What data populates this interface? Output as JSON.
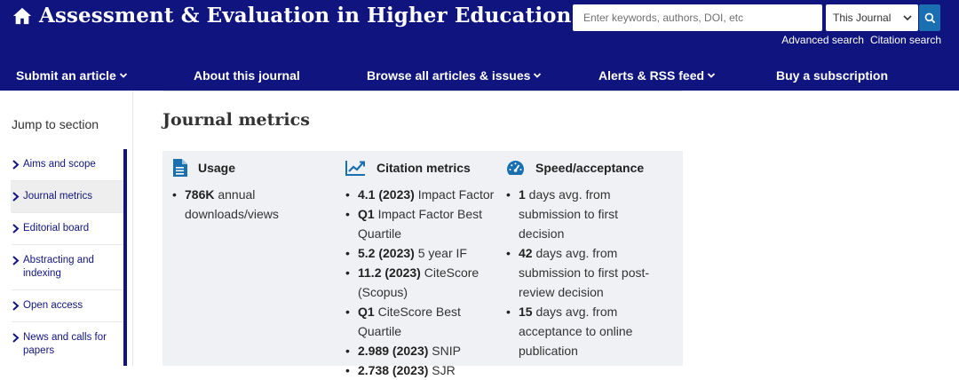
{
  "header": {
    "title": "Assessment & Evaluation in Higher Education",
    "search_placeholder": "Enter keywords, authors, DOI, etc",
    "scope_value": "This Journal",
    "advanced_search": "Advanced search",
    "citation_search": "Citation search",
    "brand_color": "#10147e"
  },
  "nav": [
    {
      "label": "Submit an article",
      "dropdown": true
    },
    {
      "label": "About this journal",
      "dropdown": false
    },
    {
      "label": "Browse all articles & issues",
      "dropdown": true
    },
    {
      "label": "Alerts & RSS feed",
      "dropdown": true
    },
    {
      "label": "Buy a subscription",
      "dropdown": false
    }
  ],
  "sidebar": {
    "title": "Jump to section",
    "items": [
      {
        "label": "Aims and scope"
      },
      {
        "label": "Journal metrics",
        "active": true
      },
      {
        "label": "Editorial board"
      },
      {
        "label": "Abstracting and indexing"
      },
      {
        "label": "Open access"
      },
      {
        "label": "News and calls for papers"
      }
    ]
  },
  "main": {
    "title": "Journal metrics",
    "usage": {
      "heading": "Usage",
      "icon": "document-icon",
      "items": [
        {
          "bold": "786K",
          "text": " annual downloads/views"
        }
      ]
    },
    "citation": {
      "heading": "Citation metrics",
      "icon": "trend-chart-icon",
      "items": [
        {
          "bold": "4.1 (2023)",
          "text": " Impact Factor"
        },
        {
          "bold": "Q1",
          "text": " Impact Factor Best Quartile"
        },
        {
          "bold": "5.2 (2023)",
          "text": " 5 year IF"
        },
        {
          "bold": "11.2 (2023)",
          "text": " CiteScore (Scopus)"
        },
        {
          "bold": "Q1",
          "text": " CiteScore Best Quartile"
        },
        {
          "bold": "2.989 (2023)",
          "text": " SNIP"
        },
        {
          "bold": "2.738 (2023)",
          "text": " SJR"
        }
      ]
    },
    "speed": {
      "heading": "Speed/acceptance",
      "icon": "speedometer-icon",
      "items": [
        {
          "bold": "1",
          "text": " days avg. from submission to first decision"
        },
        {
          "bold": "42",
          "text": " days avg. from submission to first post-review decision"
        },
        {
          "bold": "15",
          "text": " days avg. from acceptance to online publication"
        }
      ]
    }
  }
}
